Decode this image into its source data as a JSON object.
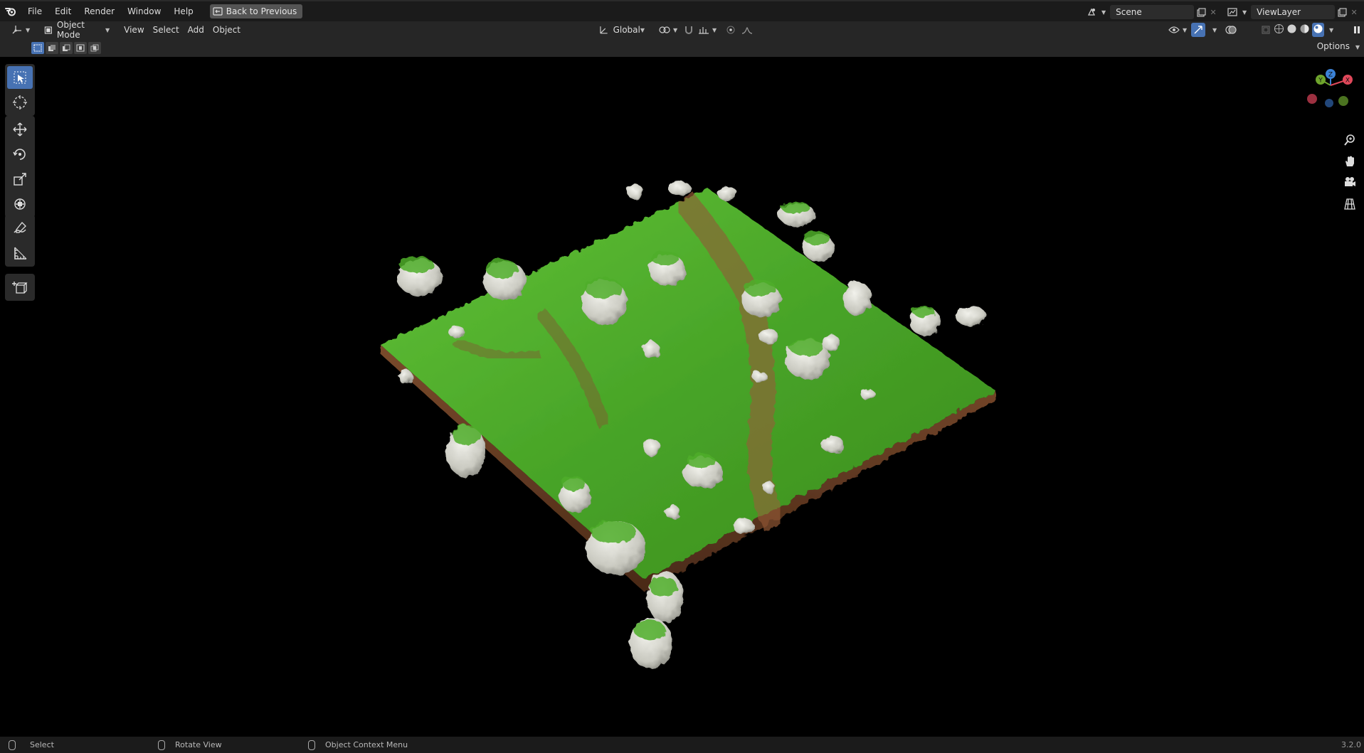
{
  "topbar": {
    "menu": [
      "File",
      "Edit",
      "Render",
      "Window",
      "Help"
    ],
    "back_label": "Back to Previous",
    "scene_name": "Scene",
    "view_layer": "ViewLayer"
  },
  "header": {
    "mode": "Object Mode",
    "menus": [
      "View",
      "Select",
      "Add",
      "Object"
    ],
    "transform_orientation": "Global"
  },
  "toolsettings": {
    "options_label": "Options"
  },
  "viewport": {
    "gizmo_axes": [
      "Y",
      "Z",
      "X"
    ]
  },
  "statusbar": {
    "select_label": "Select",
    "rotate_label": "Rotate View",
    "context_label": "Object Context Menu",
    "version": "3.2.0"
  },
  "colors": {
    "accent": "#4772b3",
    "axis_x": "#e0485a",
    "axis_y": "#6ea42c",
    "axis_z": "#3b82d6",
    "grass": "#4aa32a",
    "dirt": "#7a4a2c"
  },
  "icons": {
    "tools": [
      "select-box-icon",
      "cursor-icon",
      "move-icon",
      "rotate-icon",
      "scale-icon",
      "transform-icon",
      "annotate-icon",
      "measure-icon",
      "add-cube-icon"
    ],
    "nav": [
      "zoom-icon",
      "pan-hand-icon",
      "camera-icon",
      "ortho-grid-icon"
    ]
  }
}
